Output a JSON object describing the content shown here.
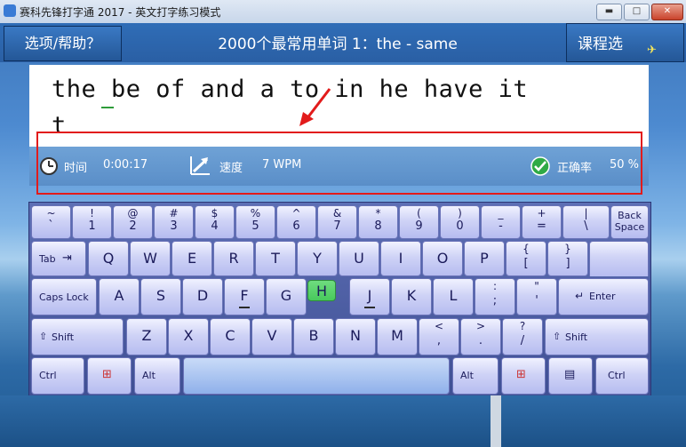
{
  "window": {
    "title": "赛科先锋打字通 2017 - 英文打字练习模式",
    "minimize_glyph": "▬",
    "maximize_glyph": "□",
    "close_glyph": "✕"
  },
  "header": {
    "help_label": "选项/帮助？",
    "lesson_title": "2000个最常用单词 1：the - same",
    "course_label": "课程选"
  },
  "typing": {
    "line1": "the be of and a to in he have it",
    "line2": "t"
  },
  "stats": {
    "time_label": "时间",
    "time_value": "0:00:17",
    "speed_label": "速度",
    "speed_value": "7 WPM",
    "accuracy_label": "正确率",
    "accuracy_value": "50 %"
  },
  "keys": {
    "backquote": {
      "top": "~",
      "bot": "`"
    },
    "k1": {
      "top": "!",
      "bot": "1"
    },
    "k2": {
      "top": "@",
      "bot": "2"
    },
    "k3": {
      "top": "#",
      "bot": "3"
    },
    "k4": {
      "top": "$",
      "bot": "4"
    },
    "k5": {
      "top": "%",
      "bot": "5"
    },
    "k6": {
      "top": "^",
      "bot": "6"
    },
    "k7": {
      "top": "&",
      "bot": "7"
    },
    "k8": {
      "top": "*",
      "bot": "8"
    },
    "k9": {
      "top": "(",
      "bot": "9"
    },
    "k0": {
      "top": ")",
      "bot": "0"
    },
    "minus": {
      "top": "_",
      "bot": "-"
    },
    "equal": {
      "top": "+",
      "bot": "="
    },
    "backslash": {
      "top": "|",
      "bot": "\\"
    },
    "backspace": "Back Space",
    "tab": "Tab",
    "q": "Q",
    "w": "W",
    "e": "E",
    "r": "R",
    "t": "T",
    "y": "Y",
    "u": "U",
    "i": "I",
    "o": "O",
    "p": "P",
    "lbracket": {
      "top": "{",
      "bot": "["
    },
    "rbracket": {
      "top": "}",
      "bot": "]"
    },
    "capslock": "Caps Lock",
    "a": "A",
    "s": "S",
    "d": "D",
    "f": "F",
    "g": "G",
    "h": "H",
    "j": "J",
    "k": "K",
    "l": "L",
    "semicolon": {
      "top": ":",
      "bot": ";"
    },
    "quote": {
      "top": "\"",
      "bot": "'"
    },
    "enter": "Enter",
    "lshift": "Shift",
    "z": "Z",
    "x": "X",
    "c": "C",
    "v": "V",
    "b": "B",
    "n": "N",
    "m": "M",
    "comma": {
      "top": "<",
      "bot": ","
    },
    "period": {
      "top": ">",
      "bot": "."
    },
    "slash": {
      "top": "?",
      "bot": "/"
    },
    "rshift": "Shift",
    "lctrl": "Ctrl",
    "lalt": "Alt",
    "ralt": "Alt",
    "rctrl": "Ctrl"
  },
  "highlighted_key": "H",
  "colors": {
    "highlight": "#48c95c",
    "red_annotation": "#e21b1b",
    "accent_blue": "#2f6db7"
  }
}
